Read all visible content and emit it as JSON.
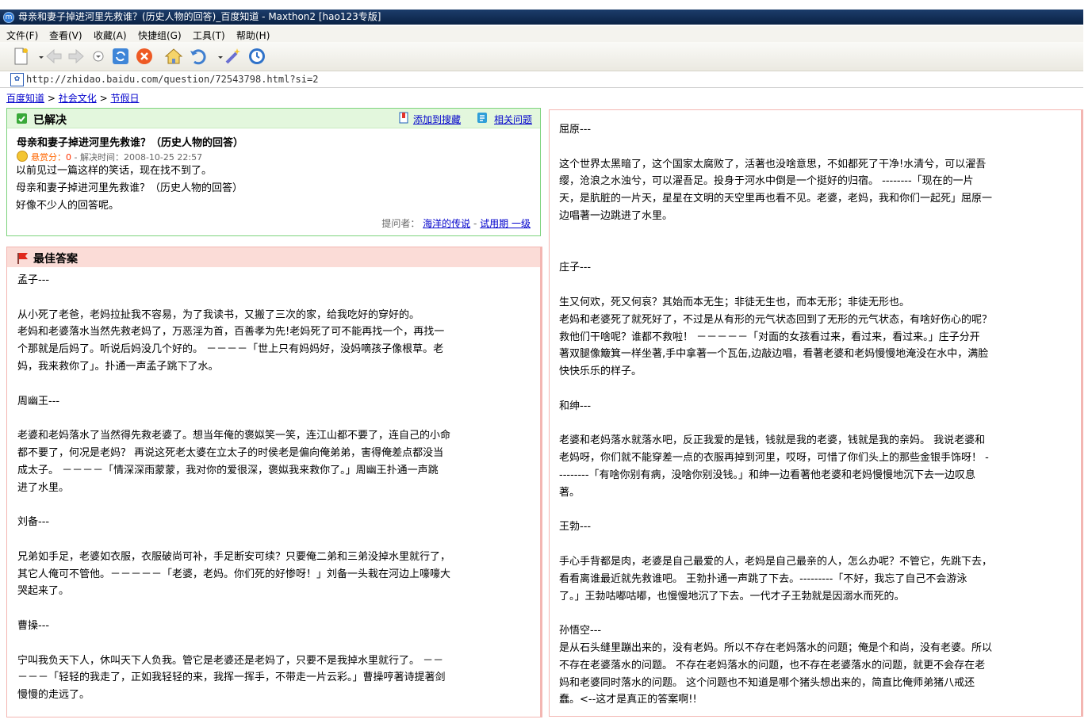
{
  "window": {
    "title": "母亲和妻子掉进河里先救谁？(历史人物的回答)_百度知道 - Maxthon2  [hao123专版]"
  },
  "menu": [
    "文件(F)",
    "查看(V)",
    "收藏(A)",
    "快捷组(G)",
    "工具(T)",
    "帮助(H)"
  ],
  "address": {
    "url": "http://zhidao.baidu.com/question/72543798.html?si=2"
  },
  "breadcrumb": [
    "百度知道",
    "社会文化",
    "节假日"
  ],
  "question": {
    "status": "已解决",
    "add_search": "添加到搜藏",
    "related": "相关问题",
    "title": "母亲和妻子掉进河里先救谁？（历史人物的回答）",
    "reward_label": "悬赏分：",
    "reward_value": "0",
    "solved_time": " - 解决时间：2008-10-25 22:57",
    "body": [
      "以前见过一篇这样的笑话，现在找不到了。",
      "母亲和妻子掉进河里先救谁？（历史人物的回答）",
      "好像不少人的回答呢。"
    ],
    "asker_label": "提问者：",
    "asker_name": "海洋的传说",
    "asker_level": "试用期 一级"
  },
  "answer": {
    "title": "最佳答案",
    "left_lines": [
      "孟子---",
      "",
      "从小死了老爸，老妈拉扯我不容易，为了我读书，又搬了三次的家，给我吃好的穿好的。",
      "老妈和老婆落水当然先救老妈了，万恶淫为首，百善孝为先!老妈死了可不能再找一个，再找一",
      "个那就是后妈了。听说后妈没几个好的。 －－－－「世上只有妈妈好，没妈嘀孩子像根草。老",
      "妈，我来救你了」。扑通一声孟子跳下了水。",
      "",
      "周幽王---",
      "",
      "老婆和老妈落水了当然得先救老婆了。想当年俺的褒姒笑一笑，连江山都不要了，连自己的小命",
      "都不要了，何况是老妈？ 再说这死老太婆在立太子的时侯老是偏向俺弟弟，害得俺差点都没当",
      "成太子。 －－－－「情深深雨蒙蒙，我对你的爱很深，褒姒我来救你了。」周幽王扑通一声跳",
      "进了水里。",
      "",
      "刘备---",
      "",
      "兄弟如手足，老婆如衣服，衣服破尚可补，手足断安可续？只要俺二弟和三弟没掉水里就行了，",
      "其它人俺可不管他。－－－－－「老婆，老妈。你们死的好惨呀！」刘备一头栽在河边上嚎嚎大",
      "哭起来了。",
      "",
      "曹操---",
      "",
      "宁叫我负天下人，休叫天下人负我。管它是老婆还是老妈了，只要不是我掉水里就行了。 －－",
      "－－－「轻轻的我走了，正如我轻轻的来，我挥一挥手，不带走一片云彩。」曹操哼著诗提著剑",
      "慢慢的走远了。"
    ],
    "right_lines": [
      "屈原---",
      "",
      "这个世界太黑暗了，这个国家太腐败了，活著也没啥意思，不如都死了干净!水清兮，可以濯吾",
      "缨，沧浪之水浊兮，可以濯吾足。投身于河水中倒是一个挺好的归宿。 --------「现在的一片",
      "天，是肮脏的一片天，星星在文明的天空里再也看不见。老婆，老妈，我和你们一起死」屈原一",
      "边唱著一边跳进了水里。",
      "",
      "",
      "庄子---",
      "",
      "生又何欢，死又何哀？其始而本无生；非徒无生也，而本无形；非徒无形也。",
      "老妈和老婆死了就死好了，不过是从有形的元气状态回到了无形的元气状态，有啥好伤心的呢？",
      "救他们干啥呢？谁都不救啦！ －－－－－「对面的女孩看过来，看过来，看过来。」庄子分开",
      "著双腿像簸箕一样坐著,手中拿著一个瓦缶,边敲边唱，看著老婆和老妈慢慢地淹没在水中，满脸",
      "快快乐乐的样子。",
      "",
      "和绅---",
      "",
      "老婆和老妈落水就落水吧，反正我爱的是钱，钱就是我的老婆，钱就是我的亲妈。 我说老婆和",
      "老妈呀，你们就不能穿差一点的衣服再掉到河里，哎呀，可惜了你们头上的那些金银手饰呀！ -",
      "--------「有啥你别有病，没啥你别没钱。」和绅一边看著他老婆和老妈慢慢地沉下去一边叹息",
      "著。",
      "",
      "王勃---",
      "",
      "手心手背都是肉，老婆是自己最爱的人，老妈是自己最亲的人，怎么办呢？不管它，先跳下去，",
      "看看离谁最近就先救谁吧。 王勃扑通一声跳了下去。---------「不好，我忘了自己不会游泳",
      "了。」王勃咕嘟咕嘟，也慢慢地沉了下去。一代才子王勃就是因溺水而死的。",
      "",
      "孙悟空---",
      "是从石头缝里蹦出来的，没有老妈。所以不存在老妈落水的问题；俺是个和尚，没有老婆。所以",
      "不存在老婆落水的问题。 不存在老妈落水的问题，也不存在老婆落水的问题，就更不会存在老",
      "妈和老婆同时落水的问题。 这个问题也不知道是哪个猪头想出来的，简直比俺师弟猪八戒还",
      "蠢。<--这才是真正的答案啊!!"
    ]
  },
  "colors": {
    "resolved_green": "#39a939",
    "answer_pink": "#fbdcd7",
    "link_blue": "#0000cc",
    "reward_red": "#ff6600"
  }
}
